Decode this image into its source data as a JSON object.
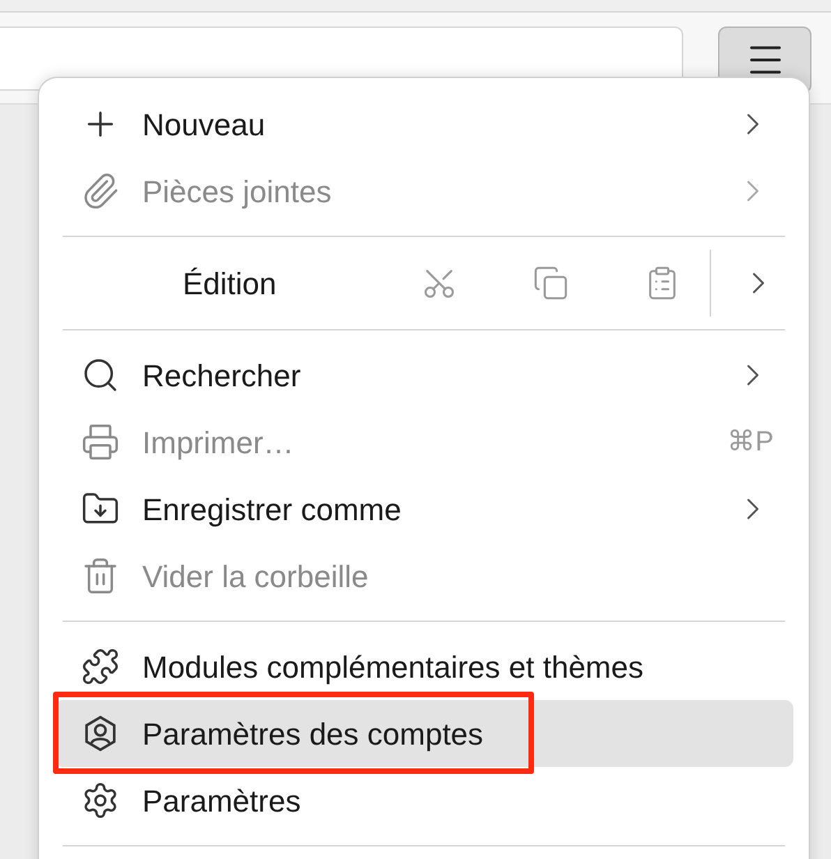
{
  "menu": {
    "items": [
      {
        "kind": "item",
        "label": "Nouveau",
        "disabled": false,
        "submenu": true,
        "selected": false,
        "annotated": false
      },
      {
        "kind": "item",
        "label": "Pièces jointes",
        "disabled": true,
        "submenu": true,
        "selected": false,
        "annotated": false
      },
      {
        "kind": "separator"
      },
      {
        "kind": "edit",
        "label": "Édition"
      },
      {
        "kind": "separator"
      },
      {
        "kind": "item",
        "label": "Rechercher",
        "disabled": false,
        "submenu": true,
        "selected": false,
        "annotated": false
      },
      {
        "kind": "item",
        "label": "Imprimer…",
        "disabled": true,
        "submenu": false,
        "shortcut": "⌘P",
        "selected": false,
        "annotated": false
      },
      {
        "kind": "item",
        "label": "Enregistrer comme",
        "disabled": false,
        "submenu": true,
        "selected": false,
        "annotated": false
      },
      {
        "kind": "item",
        "label": "Vider la corbeille",
        "disabled": true,
        "submenu": false,
        "selected": false,
        "annotated": false
      },
      {
        "kind": "separator"
      },
      {
        "kind": "item",
        "label": "Modules complémentaires et thèmes",
        "disabled": false,
        "submenu": false,
        "selected": false,
        "annotated": false
      },
      {
        "kind": "item",
        "label": "Paramètres des comptes",
        "disabled": false,
        "submenu": false,
        "selected": true,
        "annotated": true
      },
      {
        "kind": "item",
        "label": "Paramètres",
        "disabled": false,
        "submenu": false,
        "selected": false,
        "annotated": false
      },
      {
        "kind": "separator"
      }
    ]
  }
}
